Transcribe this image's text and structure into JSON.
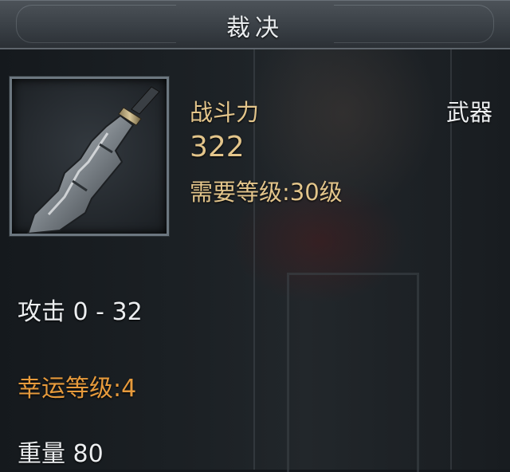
{
  "window": {
    "title": "裁决"
  },
  "item": {
    "icon": "sword-icon",
    "power_label": "战斗力",
    "power_value": "322",
    "level_requirement": "需要等级:30级",
    "type": "武器"
  },
  "stats": {
    "attack": "攻击 0 - 32",
    "luck": "幸运等级:4",
    "weight": "重量 80"
  },
  "colors": {
    "label_gold": "#e3c58b",
    "stat_white": "#eceef0",
    "luck_orange": "#e69a3c"
  }
}
